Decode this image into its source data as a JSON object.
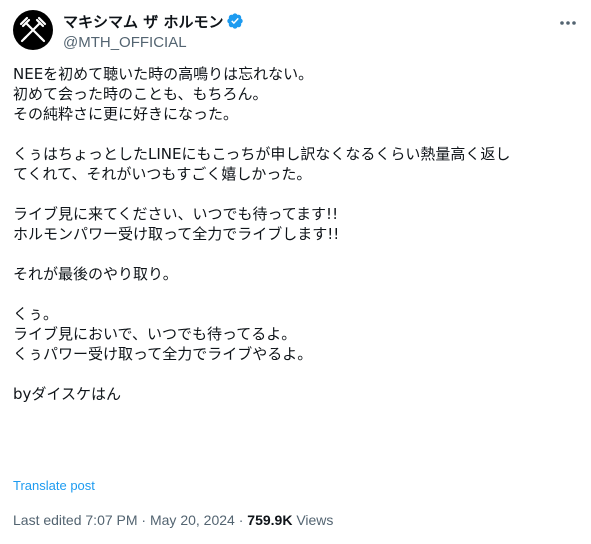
{
  "author": {
    "display_name": "マキシマム ザ ホルモン",
    "handle": "@MTH_OFFICIAL",
    "verified_icon": "verified-badge-icon",
    "avatar_icon": "crossed-forks-logo"
  },
  "tweet": {
    "lines": [
      "NEEを初めて聴いた時の高鳴りは忘れない。",
      "初めて会った時のことも、もちろん。",
      "その純粋さに更に好きになった。",
      "",
      "くぅはちょっとしたLINEにもこっちが申し訳なくなるくらい熱量高く返し",
      "てくれて、それがいつもすごく嬉しかった。",
      "",
      "ライブ見に来てください、いつでも待ってます!!",
      "ホルモンパワー受け取って全力でライブします!!",
      "",
      "それが最後のやり取り。",
      "",
      "くぅ。",
      "ライブ見においで、いつでも待ってるよ。",
      "くぅパワー受け取って全力でライブやるよ。",
      "",
      "byダイスケはん"
    ]
  },
  "translate_label": "Translate post",
  "meta": {
    "edited_label": "Last edited",
    "time": "7:07 PM",
    "separator": "·",
    "date": "May 20, 2024",
    "views_count": "759.9K",
    "views_label": "Views"
  },
  "colors": {
    "text": "#0f1419",
    "secondary": "#536471",
    "link": "#1d9bf0",
    "verified": "#1d9bf0"
  }
}
